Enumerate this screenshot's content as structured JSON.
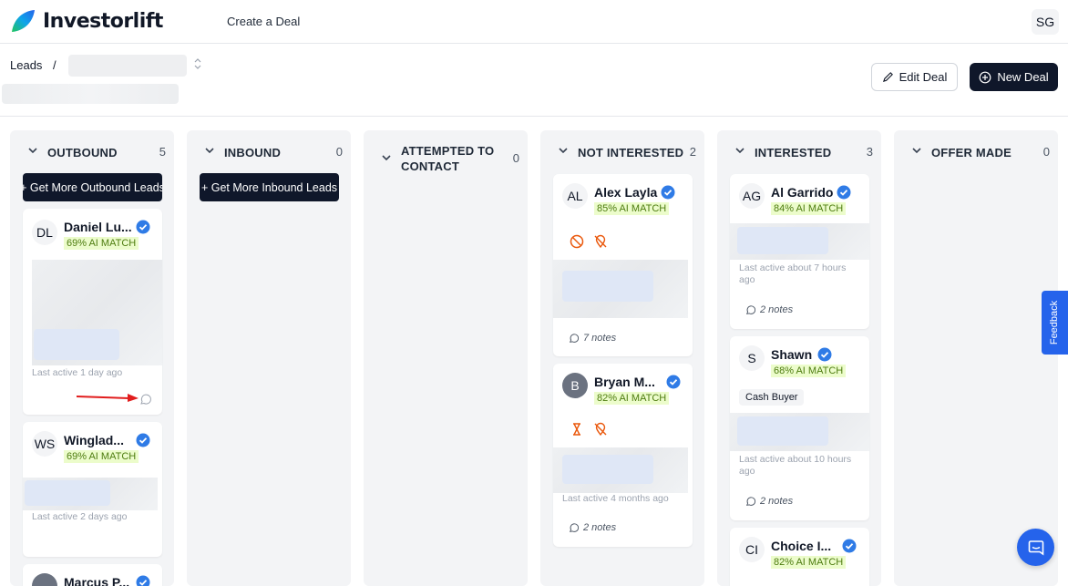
{
  "app": {
    "name": "Investorlift",
    "nav_create": "Create a Deal",
    "user_initials": "SG"
  },
  "breadcrumb": {
    "root": "Leads",
    "separator": "/"
  },
  "actions": {
    "edit": "Edit Deal",
    "new": "New Deal"
  },
  "colors": {
    "accent": "#2563eb",
    "dark": "#0f172a",
    "match_bg": "#ecfccb",
    "match_text": "#4d7c0f",
    "column_bg": "#f3f4f6"
  },
  "columns": [
    {
      "title": "OUTBOUND",
      "count": "5",
      "button": "+ Get More Outbound Leads"
    },
    {
      "title": "INBOUND",
      "count": "0",
      "button": "+ Get More Inbound Leads"
    },
    {
      "title_l1": "ATTEMPTED TO",
      "title_l2": "CONTACT",
      "count": "0"
    },
    {
      "title": "NOT INTERESTED",
      "count": "2"
    },
    {
      "title": "INTERESTED",
      "count": "3"
    },
    {
      "title": "OFFER MADE",
      "count": "0"
    }
  ],
  "cards": {
    "daniel": {
      "initials": "DL",
      "name": "Daniel Lu...",
      "match": "69% AI MATCH",
      "last_active": "Last active 1 day ago"
    },
    "winglad": {
      "initials": "WS",
      "name": "Winglad...",
      "match": "69% AI MATCH",
      "last_active": "Last active 2 days ago"
    },
    "marcus": {
      "name": "Marcus P..."
    },
    "alex": {
      "initials": "AL",
      "name": "Alex Layla",
      "match": "85% AI MATCH",
      "notes": "7 notes"
    },
    "bryan": {
      "initials": "B",
      "name": "Bryan M...",
      "match": "82% AI MATCH",
      "last_active": "Last active 4 months ago",
      "notes": "2 notes"
    },
    "al": {
      "initials": "AG",
      "name": "Al Garrido",
      "match": "84% AI MATCH",
      "last_active_l1": "Last active about 7 hours",
      "last_active_l2": "ago",
      "notes": "2 notes"
    },
    "shawn": {
      "initials": "S",
      "name": "Shawn",
      "match": "68% AI MATCH",
      "tag": "Cash Buyer",
      "last_active_l1": "Last active about 10 hours",
      "last_active_l2": "ago",
      "notes": "2 notes"
    },
    "choice": {
      "initials": "CI",
      "name": "Choice I...",
      "match": "82% AI MATCH"
    }
  },
  "widgets": {
    "feedback": "Feedback"
  },
  "icons": [
    "logo-leaf-icon",
    "chevron-down-icon",
    "up-down-caret-icon",
    "pencil-icon",
    "plus-circle-icon",
    "verified-badge-icon",
    "comment-icon",
    "ban-icon",
    "location-off-icon",
    "hourglass-icon",
    "chat-icon",
    "red-arrow-annotation"
  ]
}
